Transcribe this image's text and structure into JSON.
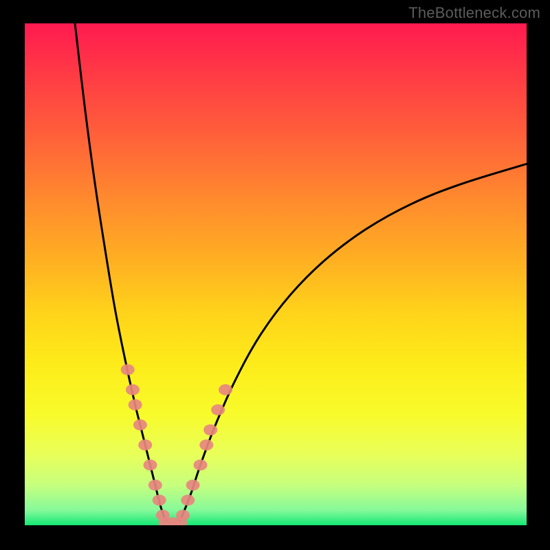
{
  "watermark": "TheBottleneck.com",
  "chart_data": {
    "type": "line",
    "title": "",
    "xlabel": "",
    "ylabel": "",
    "xlim": [
      0,
      100
    ],
    "ylim": [
      0,
      100
    ],
    "grid": false,
    "annotations": [
      {
        "text": "TheBottleneck.com",
        "position": "top-right",
        "color": "#5c5c5c"
      }
    ],
    "background_gradient": {
      "direction": "vertical",
      "stops": [
        {
          "pos": 0.0,
          "color": "#ff1a50"
        },
        {
          "pos": 0.35,
          "color": "#ff8a2e"
        },
        {
          "pos": 0.68,
          "color": "#fdec1a"
        },
        {
          "pos": 0.92,
          "color": "#c6ff7e"
        },
        {
          "pos": 1.0,
          "color": "#14e874"
        }
      ]
    },
    "series": [
      {
        "name": "left-branch-curve",
        "color": "#000000",
        "style": "line",
        "x": [
          10,
          12,
          14,
          16,
          18,
          20,
          22,
          23,
          24,
          25,
          26,
          27,
          28
        ],
        "y": [
          100,
          83,
          68,
          55,
          43,
          33,
          24,
          20,
          16,
          12,
          8,
          4,
          1
        ]
      },
      {
        "name": "right-branch-curve",
        "color": "#000000",
        "style": "line",
        "x": [
          31,
          33,
          35,
          38,
          42,
          47,
          53,
          60,
          68,
          77,
          87,
          100
        ],
        "y": [
          1,
          6,
          12,
          20,
          29,
          38,
          46,
          53,
          59,
          64,
          68,
          72
        ]
      },
      {
        "name": "left-branch-markers",
        "color": "#e7877f",
        "style": "markers",
        "x": [
          20.5,
          21.5,
          22.0,
          23.0,
          24.0,
          25.0,
          26.0,
          26.8,
          27.5
        ],
        "y": [
          31,
          27,
          24,
          20,
          16,
          12,
          8,
          5,
          2
        ]
      },
      {
        "name": "right-branch-markers",
        "color": "#e7877f",
        "style": "markers",
        "x": [
          31.5,
          32.5,
          33.5,
          35.0,
          36.2,
          37.0,
          38.5,
          40.0
        ],
        "y": [
          2,
          5,
          8,
          12,
          16,
          19,
          23,
          27
        ]
      },
      {
        "name": "valley-floor-markers",
        "color": "#e7877f",
        "style": "markers",
        "x": [
          28.0,
          29.5,
          31.0
        ],
        "y": [
          0.5,
          0.5,
          0.5
        ]
      }
    ]
  }
}
